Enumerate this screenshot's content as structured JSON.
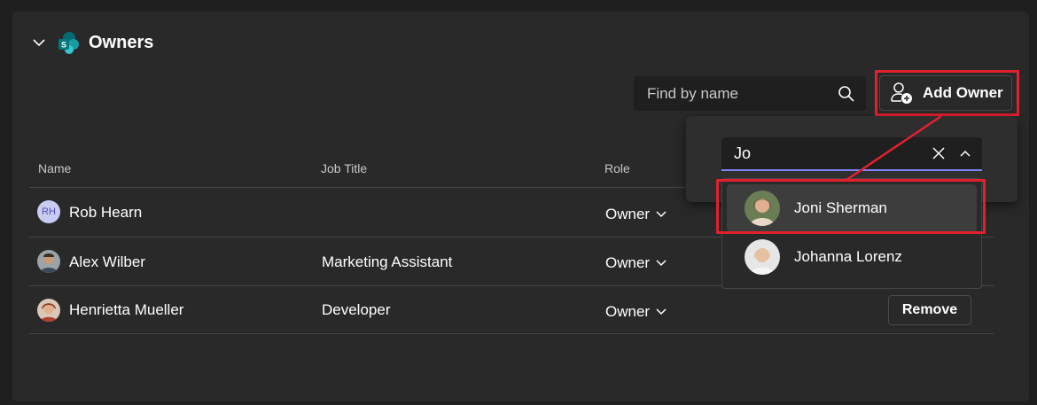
{
  "section": {
    "title": "Owners"
  },
  "toolbar": {
    "search_placeholder": "Find by name",
    "add_owner_label": "Add Owner"
  },
  "table": {
    "columns": [
      "Name",
      "Job Title",
      "Role"
    ],
    "rows": [
      {
        "initials": "RH",
        "name": "Rob Hearn",
        "job_title": "",
        "role": "Owner"
      },
      {
        "initials": "",
        "name": "Alex Wilber",
        "job_title": "Marketing Assistant",
        "role": "Owner"
      },
      {
        "initials": "",
        "name": "Henrietta Mueller",
        "job_title": "Developer",
        "role": "Owner",
        "action": "Remove"
      }
    ]
  },
  "people_picker": {
    "query": "Jo",
    "suggestions": [
      {
        "name": "Joni Sherman",
        "highlighted": true
      },
      {
        "name": "Johanna Lorenz",
        "highlighted": false
      }
    ]
  },
  "colors": {
    "background": "#1f1f1f",
    "card": "#292929",
    "highlight": "#e3202e",
    "input_underline": "#7f85f5"
  }
}
